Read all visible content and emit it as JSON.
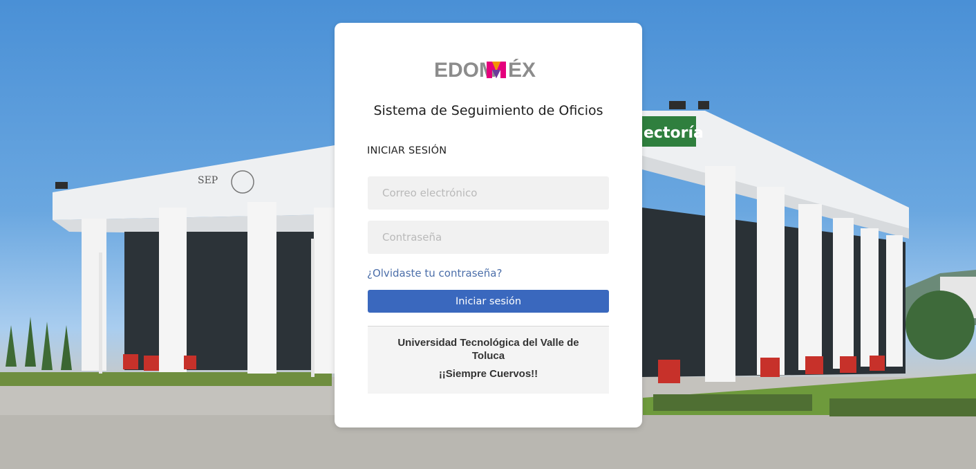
{
  "brand": {
    "logo_text_prefix": "EDOM",
    "logo_text_suffix": "ÉX",
    "colors": {
      "logo_gray": "#8c8c8c",
      "logo_magenta": "#e4007c",
      "logo_orange": "#f39200",
      "logo_purple": "#6a3d9a",
      "logo_blue": "#00a0e3",
      "primary_button": "#3a68be",
      "link": "#4b6ea9"
    }
  },
  "background": {
    "building_sign_text": "ectoría",
    "sep_label": "SEP"
  },
  "login": {
    "system_title": "Sistema de Seguimiento de Oficios",
    "heading": "INICIAR SESIÓN",
    "email_placeholder": "Correo electrónico",
    "password_placeholder": "Contraseña",
    "forgot_password": "¿Olvidaste tu contraseña?",
    "submit_label": "Iniciar sesión"
  },
  "footer": {
    "university": "Universidad Tecnológica del Valle de Toluca",
    "motto": "¡¡Siempre Cuervos!!"
  }
}
